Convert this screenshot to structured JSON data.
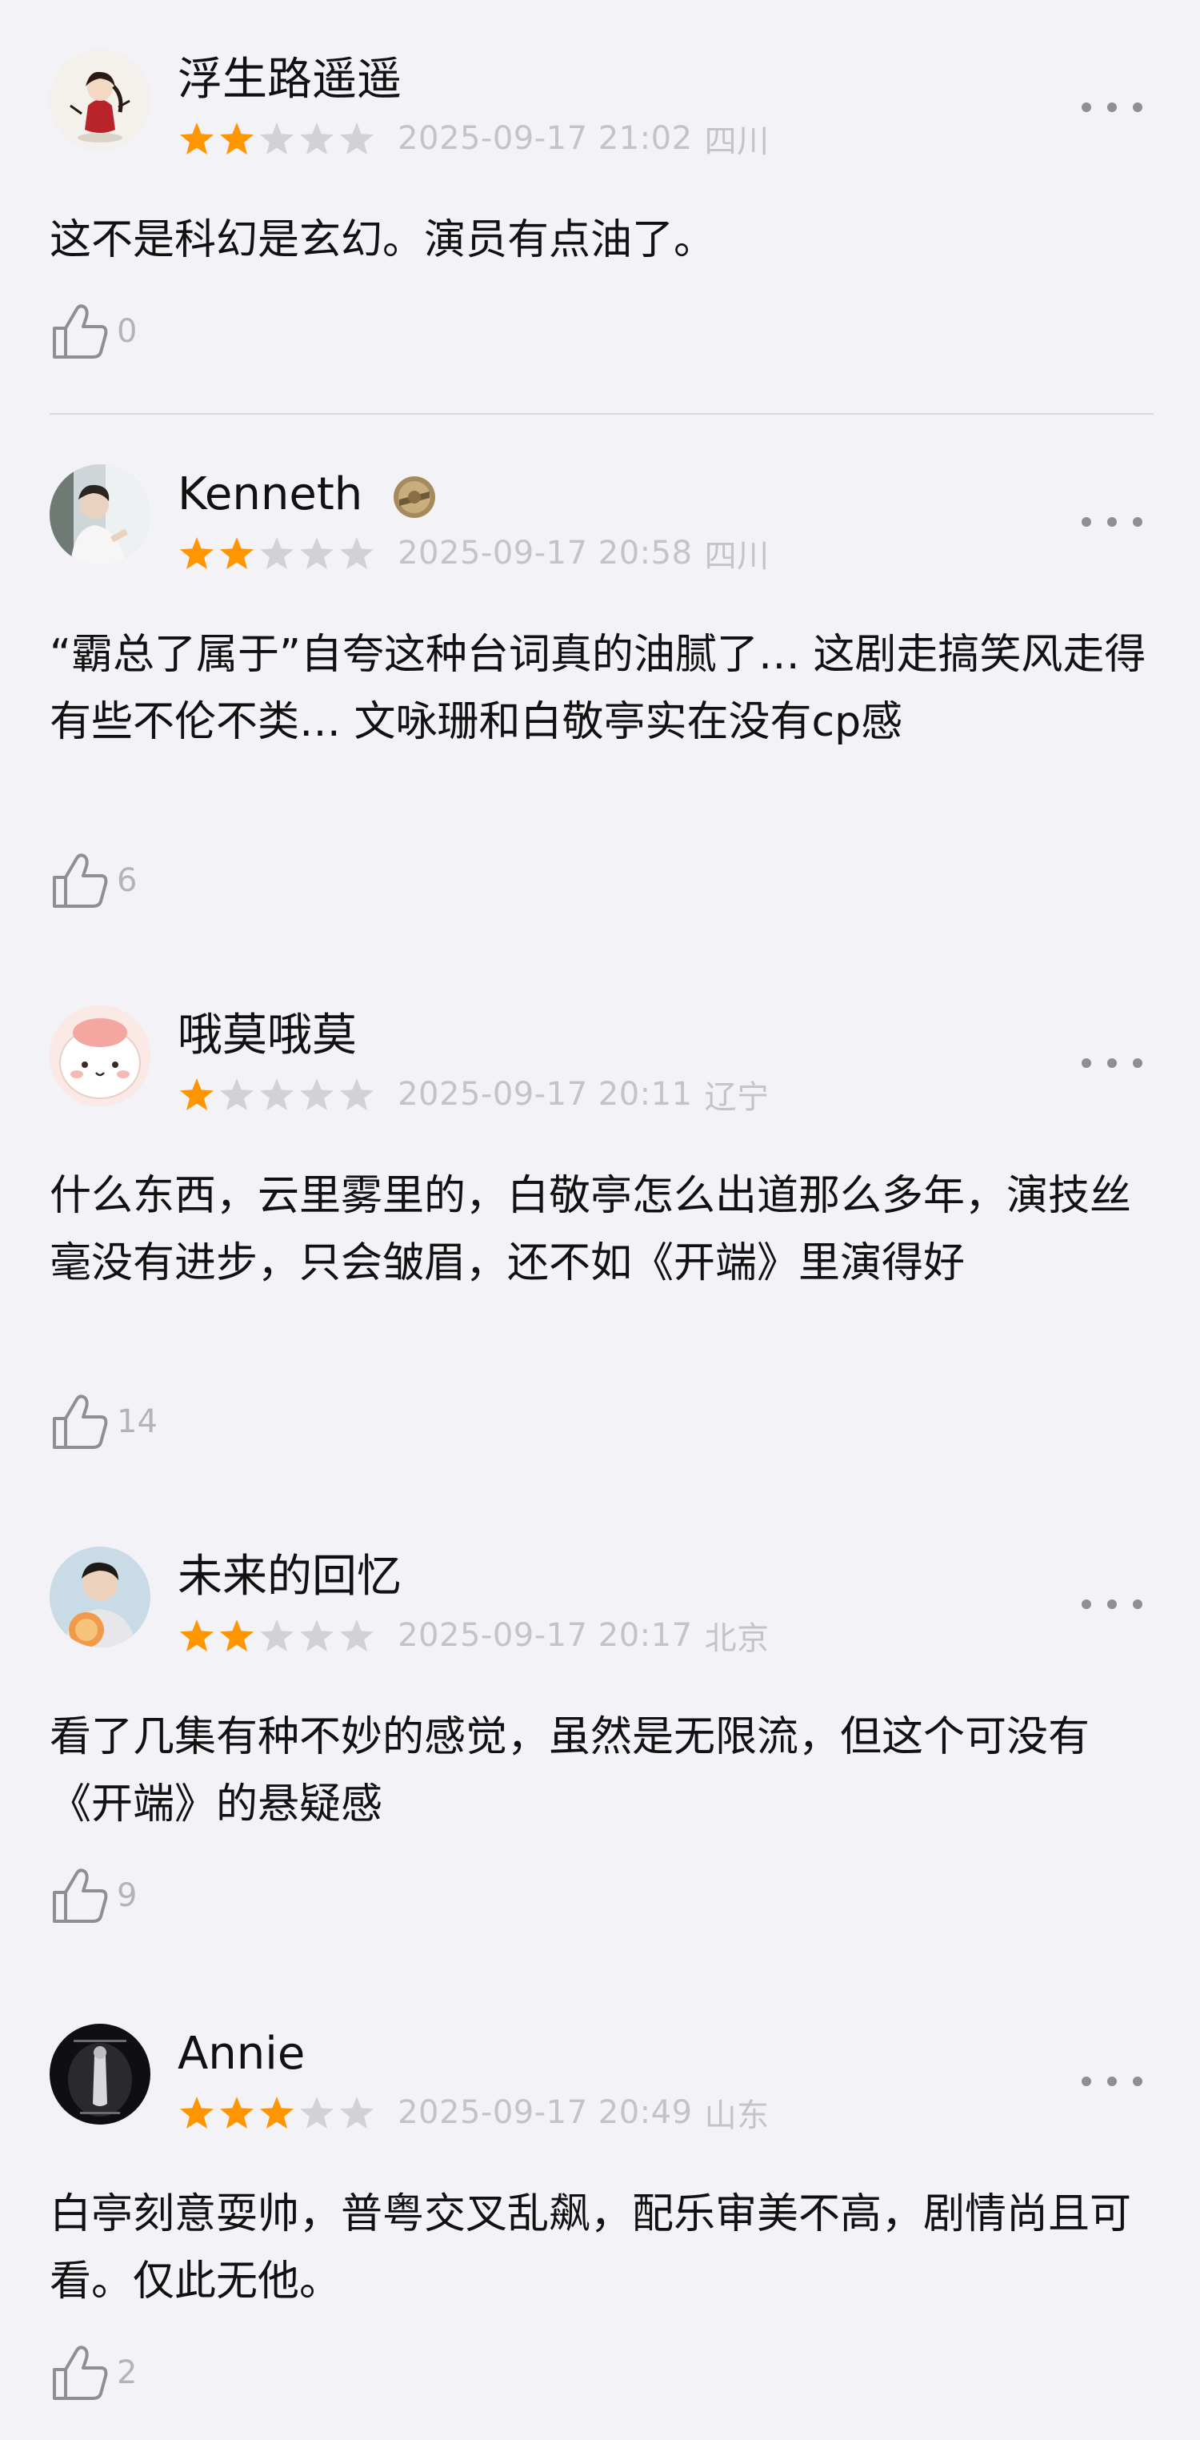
{
  "reviews": [
    {
      "name": "浮生路遥遥",
      "rating": 2,
      "date": "2025-09-17 21:02",
      "location": "四川",
      "content": "这不是科幻是玄幻。演员有点油了。",
      "likes": "0",
      "avatar_icon": "avatar-anime-girl"
    },
    {
      "name": "Kenneth",
      "rating": 2,
      "date": "2025-09-17 20:58",
      "location": "四川",
      "content": "“霸总了属于”自夸这种台词真的油腻了… 这剧走搞笑风走得有些不伦不类… 文咏珊和白敬亭实在没有cp感",
      "likes": "6",
      "avatar_icon": "avatar-person-window",
      "badge_icon": "medal-badge-icon"
    },
    {
      "name": "哦莫哦莫",
      "rating": 1,
      "date": "2025-09-17 20:11",
      "location": "辽宁",
      "content": "什么东西，云里雾里的，白敬亭怎么出道那么多年，演技丝毫没有进步，只会皱眉，还不如《开端》里演得好",
      "likes": "14",
      "avatar_icon": "avatar-cartoon-pink"
    },
    {
      "name": "未来的回忆",
      "rating": 2,
      "date": "2025-09-17 20:17",
      "location": "北京",
      "content": "看了几集有种不妙的感觉，虽然是无限流，但这个可没有《开端》的悬疑感",
      "likes": "9",
      "avatar_icon": "avatar-man-portrait"
    },
    {
      "name": "Annie",
      "rating": 3,
      "date": "2025-09-17 20:49",
      "location": "山东",
      "content": "白亭刻意耍帅，普粤交叉乱飙，配乐审美不高，剧情尚且可看。仅此无他。",
      "likes": "2",
      "avatar_icon": "avatar-dark-poster"
    }
  ],
  "colors": {
    "star_filled": "#ff9500",
    "star_empty": "#d1d1d6",
    "meta_text": "#c4c4c8",
    "background": "#f2f2f7"
  },
  "icons": {
    "more": "more-dots-icon",
    "like": "thumbs-up-icon",
    "star": "star-icon"
  }
}
